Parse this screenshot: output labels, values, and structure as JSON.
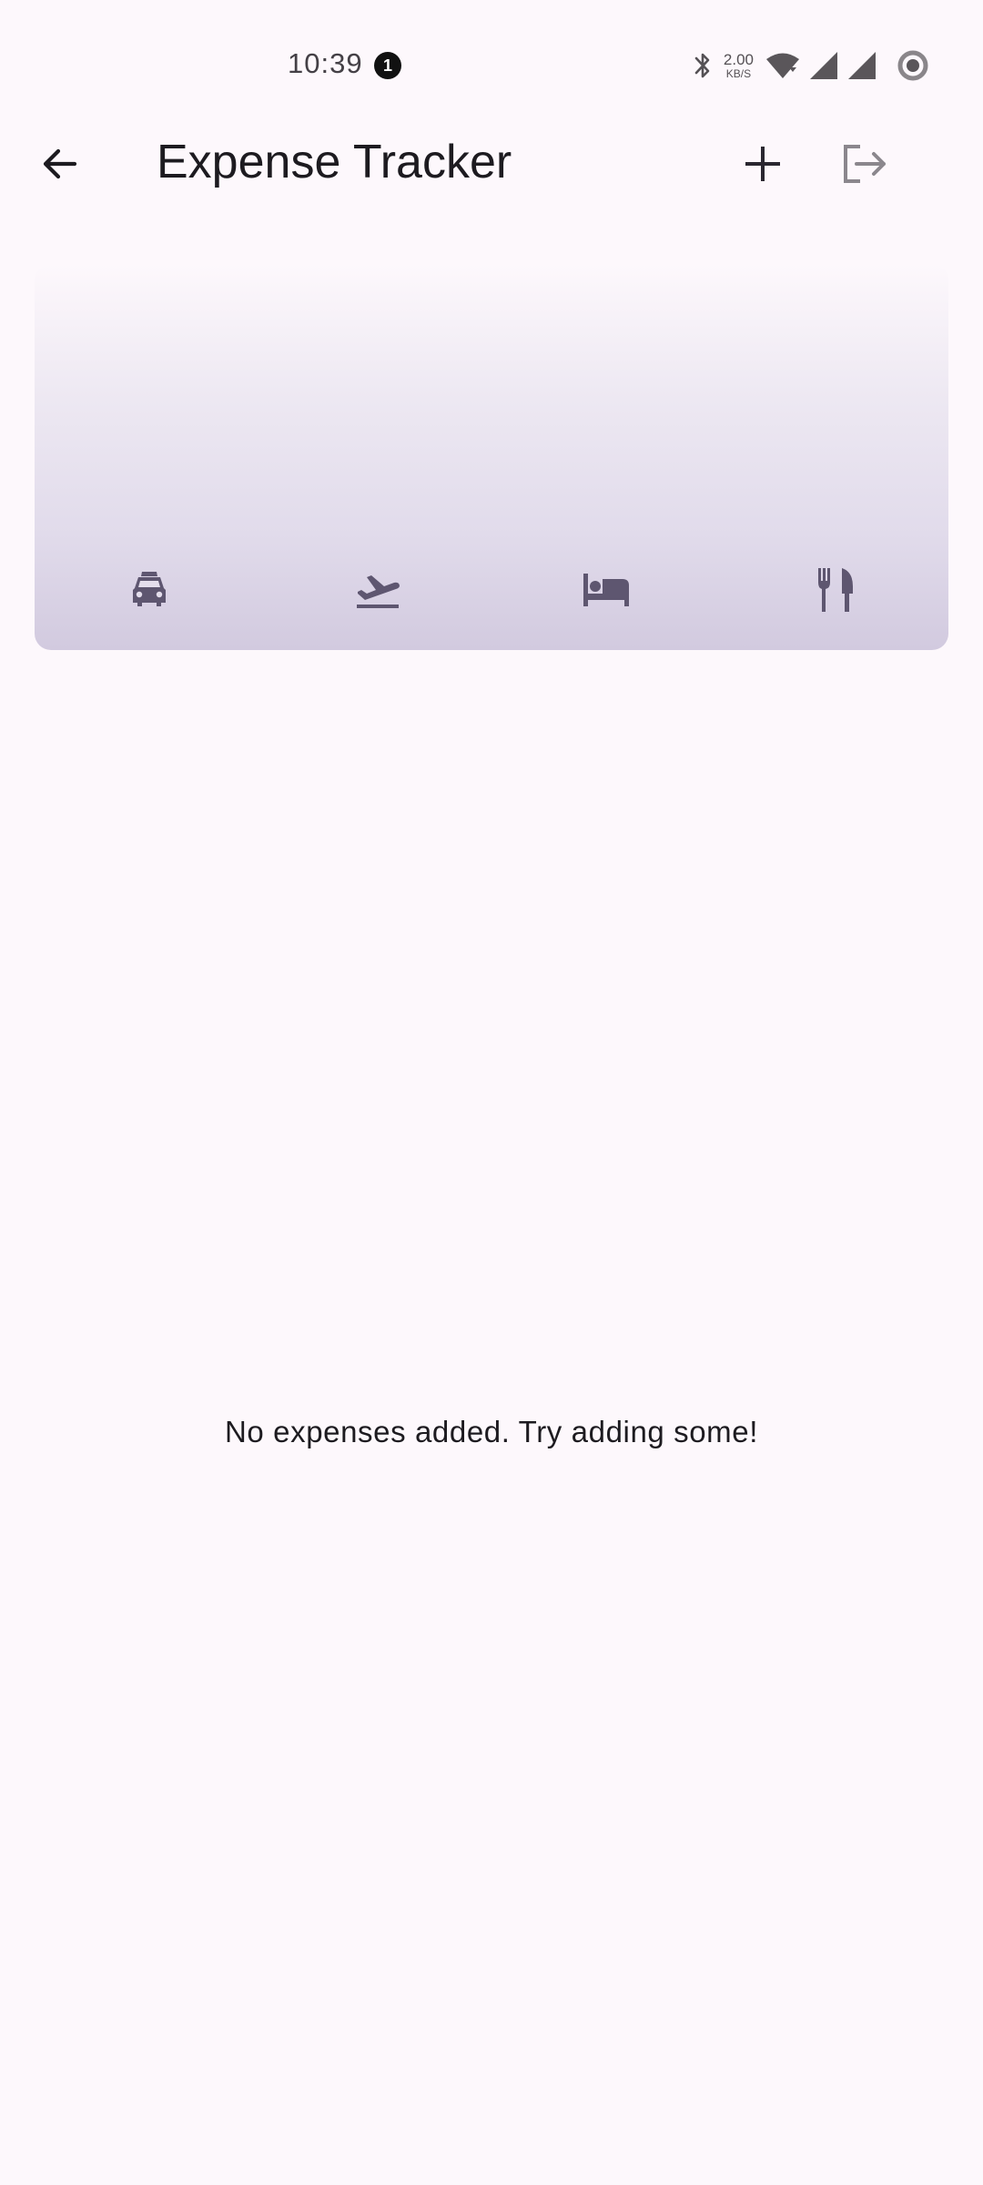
{
  "status_bar": {
    "time": "10:39",
    "notification_count": "1",
    "net_speed_value": "2.00",
    "net_speed_unit": "KB/S",
    "icons": [
      "bluetooth-icon",
      "wifi-icon",
      "signal-icon",
      "signal-icon",
      "battery-ring-icon"
    ]
  },
  "app_bar": {
    "title": "Expense Tracker",
    "back_icon": "arrow-back-icon",
    "add_icon": "add-icon",
    "logout_icon": "logout-icon"
  },
  "chart": {
    "categories": [
      {
        "name": "car-icon"
      },
      {
        "name": "flight-takeoff-icon"
      },
      {
        "name": "bed-icon"
      },
      {
        "name": "restaurant-icon"
      }
    ],
    "values": [
      0,
      0,
      0,
      0
    ]
  },
  "empty_state": {
    "message": "No expenses added. Try adding some!"
  },
  "colors": {
    "background": "#fdf8fc",
    "icon": "#5e5670",
    "text": "#1d1b20",
    "card_bottom": "#d2cadf"
  }
}
